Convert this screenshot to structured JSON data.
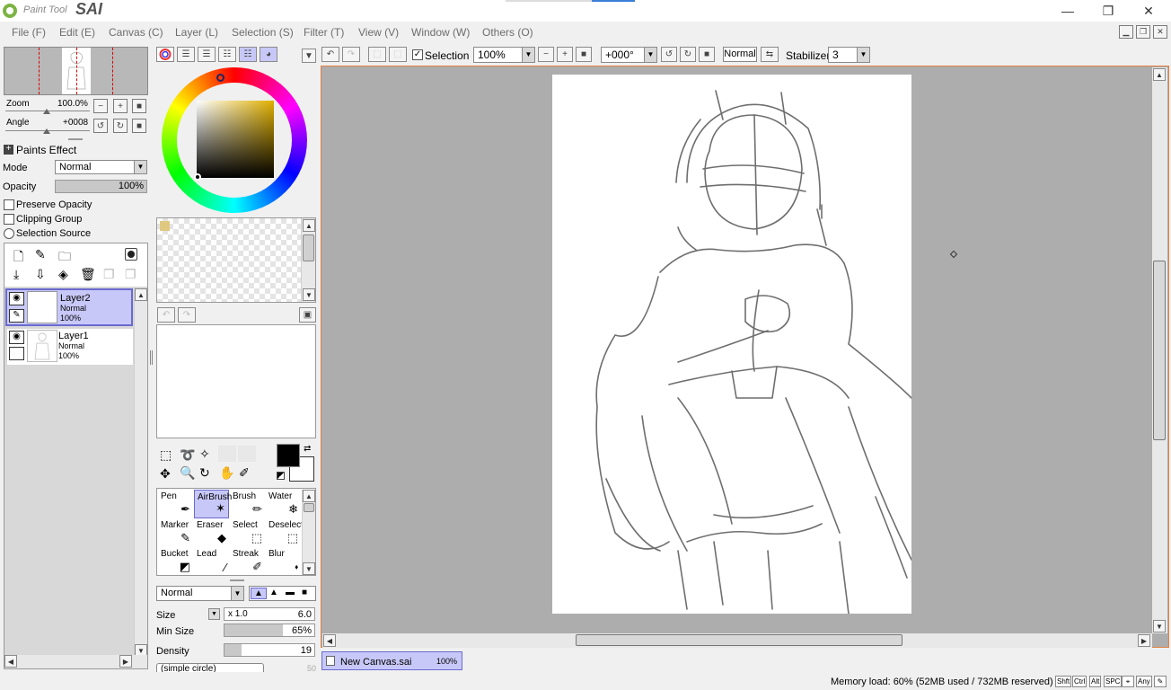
{
  "app": {
    "logo_small": "Paint Tool",
    "logo_big": "SAI",
    "window_controls": [
      "minimize-icon",
      "restore-icon",
      "close-icon"
    ]
  },
  "menu": [
    "File (F)",
    "Edit (E)",
    "Canvas (C)",
    "Layer (L)",
    "Selection (S)",
    "Filter (T)",
    "View (V)",
    "Window (W)",
    "Others (O)"
  ],
  "navigator": {
    "zoom_label": "Zoom",
    "zoom_value": "100.0%",
    "angle_label": "Angle",
    "angle_value": "+0008"
  },
  "layer_props": {
    "paints_effect": "Paints Effect",
    "mode_label": "Mode",
    "mode_value": "Normal",
    "opacity_label": "Opacity",
    "opacity_value": "100%",
    "preserve_opacity": "Preserve Opacity",
    "clipping_group": "Clipping Group",
    "selection_source": "Selection Source"
  },
  "layers": [
    {
      "name": "Layer2",
      "mode": "Normal",
      "opacity": "100%",
      "selected": true
    },
    {
      "name": "Layer1",
      "mode": "Normal",
      "opacity": "100%",
      "selected": false
    }
  ],
  "toolbar": {
    "selection_label": "Selection",
    "zoom_value": "100%",
    "angle_value": "+000°",
    "blend_mode": "Normal",
    "stabilizer_label": "Stabilizer",
    "stabilizer_value": "3"
  },
  "tools": [
    {
      "name": "Pen",
      "icon": "pen-icon"
    },
    {
      "name": "AirBrush",
      "icon": "airbrush-icon",
      "selected": true
    },
    {
      "name": "Brush",
      "icon": "brush-icon"
    },
    {
      "name": "Water",
      "icon": "water-icon"
    },
    {
      "name": "Marker",
      "icon": "marker-icon"
    },
    {
      "name": "Eraser",
      "icon": "eraser-icon"
    },
    {
      "name": "Select",
      "icon": "select-icon"
    },
    {
      "name": "Deselect",
      "icon": "deselect-icon"
    },
    {
      "name": "Bucket",
      "icon": "bucket-icon"
    },
    {
      "name": "Lead",
      "icon": "lead-icon"
    },
    {
      "name": "Streak",
      "icon": "streak-icon"
    },
    {
      "name": "Blur",
      "icon": "blur-icon"
    }
  ],
  "brush_settings": {
    "mode": "Normal",
    "size_label": "Size",
    "size_multiplier": "x 1.0",
    "size_value": "6.0",
    "min_size_label": "Min Size",
    "min_size_value": "65%",
    "min_size_fraction": 0.65,
    "density_label": "Density",
    "density_value": "19",
    "density_fraction": 0.19,
    "shape": "(simple circle)",
    "shape_value": "50"
  },
  "document_tab": {
    "name": "New Canvas.sai",
    "zoom": "100%"
  },
  "status": {
    "memory": "Memory load: 60% (52MB used / 732MB reserved)",
    "keys": [
      "Shft",
      "Ctrl",
      "Alt",
      "SPC",
      "Any"
    ]
  },
  "colors": {
    "primary": "#000000",
    "secondary": "#ffffff",
    "accent": "#e08040",
    "selection_blue": "#c8c8f8"
  }
}
